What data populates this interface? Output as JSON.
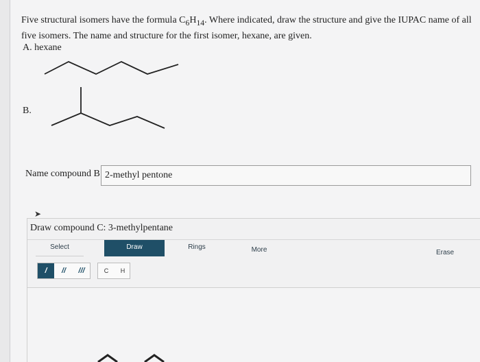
{
  "question": {
    "text_before": "Five structural isomers have the formula C",
    "sub1": "6",
    "h": "H",
    "sub2": "14",
    "text_after": ". Where indicated, draw the structure and give the IUPAC name of all five isomers. The name and structure for the first isomer, hexane, are given."
  },
  "part_a": {
    "label": "A. hexane"
  },
  "part_b": {
    "label": "B."
  },
  "name_b": {
    "label": "Name compound B",
    "value": "2-methyl pentone"
  },
  "draw_c": {
    "title": "Draw compound C: 3-methylpentane",
    "tabs": {
      "select": "Select",
      "draw": "Draw",
      "rings": "Rings",
      "more": "More",
      "erase": "Erase"
    },
    "bonds": {
      "single": "/",
      "double": "//",
      "triple": "///"
    },
    "atoms": {
      "carbon": "C",
      "hydrogen": "H"
    }
  },
  "colors": {
    "accent": "#1f4f67",
    "background": "#f4f4f5"
  }
}
